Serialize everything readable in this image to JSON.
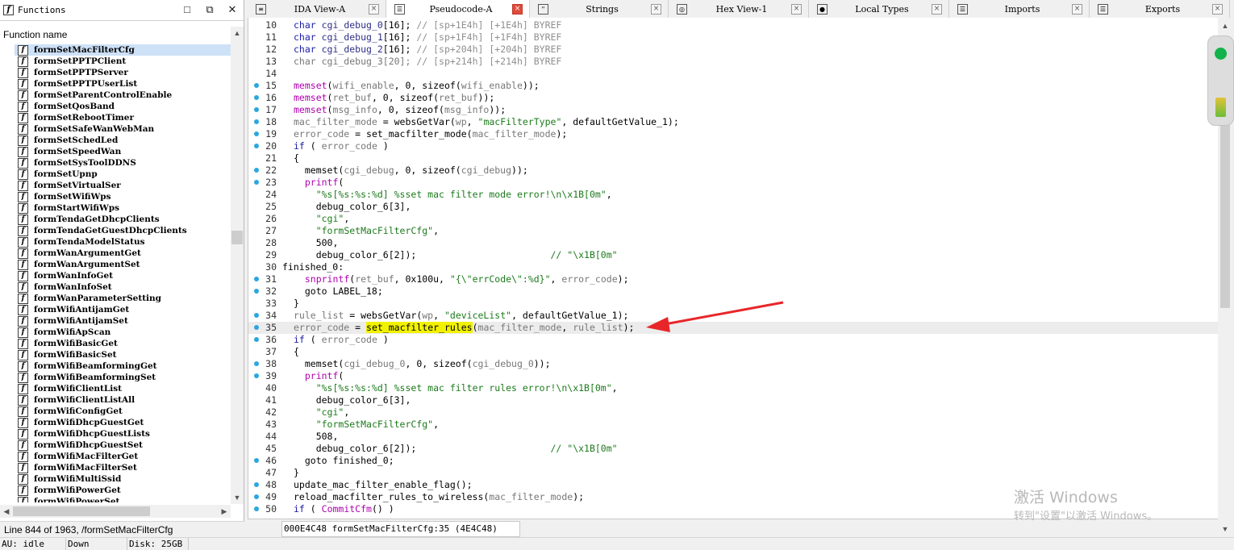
{
  "functions_pane": {
    "title": "Functions",
    "column_header": "Function name",
    "selected_index": 0,
    "items": [
      "formSetMacFilterCfg",
      "formSetPPTPClient",
      "formSetPPTPServer",
      "formSetPPTPUserList",
      "formSetParentControlEnable",
      "formSetQosBand",
      "formSetRebootTimer",
      "formSetSafeWanWebMan",
      "formSetSchedLed",
      "formSetSpeedWan",
      "formSetSysToolDDNS",
      "formSetUpnp",
      "formSetVirtualSer",
      "formSetWifiWps",
      "formStartWifiWps",
      "formTendaGetDhcpClients",
      "formTendaGetGuestDhcpClients",
      "formTendaModelStatus",
      "formWanArgumentGet",
      "formWanArgumentSet",
      "formWanInfoGet",
      "formWanInfoSet",
      "formWanParameterSetting",
      "formWifiAntijamGet",
      "formWifiAntijamSet",
      "formWifiApScan",
      "formWifiBasicGet",
      "formWifiBasicSet",
      "formWifiBeamformingGet",
      "formWifiBeamformingSet",
      "formWifiClientList",
      "formWifiClientListAll",
      "formWifiConfigGet",
      "formWifiDhcpGuestGet",
      "formWifiDhcpGuestLists",
      "formWifiDhcpGuestSet",
      "formWifiMacFilterGet",
      "formWifiMacFilterSet",
      "formWifiMultiSsid",
      "formWifiPowerGet",
      "formWifiPowerSet"
    ],
    "status": "Line 844 of 1963, /formSetMacFilterCfg"
  },
  "tabs": [
    {
      "label": "IDA View-A",
      "icon": "ida-view-icon",
      "active": false
    },
    {
      "label": "Pseudocode-A",
      "icon": "pseudocode-icon",
      "active": true
    },
    {
      "label": "Strings",
      "icon": "strings-icon",
      "active": false
    },
    {
      "label": "Hex View-1",
      "icon": "hex-view-icon",
      "active": false
    },
    {
      "label": "Local Types",
      "icon": "local-types-icon",
      "active": false
    },
    {
      "label": "Imports",
      "icon": "imports-icon",
      "active": false
    },
    {
      "label": "Exports",
      "icon": "exports-icon",
      "active": false
    }
  ],
  "code": {
    "highlight_line": 35,
    "lines": [
      {
        "n": "10",
        "dot": false,
        "t": [
          [
            "kw",
            "char "
          ],
          [
            "var",
            "cgi_debug_0"
          ],
          [
            "",
            "[16]; "
          ],
          [
            "com",
            "// [sp+1E4h] [+1E4h] BYREF"
          ]
        ]
      },
      {
        "n": "11",
        "dot": false,
        "t": [
          [
            "kw",
            "char "
          ],
          [
            "var",
            "cgi_debug_1"
          ],
          [
            "",
            "[16]; "
          ],
          [
            "com",
            "// [sp+1F4h] [+1F4h] BYREF"
          ]
        ]
      },
      {
        "n": "12",
        "dot": false,
        "t": [
          [
            "kw",
            "char "
          ],
          [
            "var",
            "cgi_debug_2"
          ],
          [
            "",
            "[16]; "
          ],
          [
            "com",
            "// [sp+204h] [+204h] BYREF"
          ]
        ]
      },
      {
        "n": "13",
        "dot": false,
        "t": [
          [
            "gray",
            "char cgi_debug_3[20]; "
          ],
          [
            "com",
            "// [sp+214h] [+214h] BYREF"
          ]
        ]
      },
      {
        "n": "14",
        "dot": false,
        "t": []
      },
      {
        "n": "15",
        "dot": true,
        "t": [
          [
            "fn",
            "memset"
          ],
          [
            "",
            "("
          ],
          [
            "gray",
            "wifi_enable"
          ],
          [
            "",
            ", 0, sizeof("
          ],
          [
            "gray",
            "wifi_enable"
          ],
          [
            "",
            "));"
          ]
        ]
      },
      {
        "n": "16",
        "dot": true,
        "t": [
          [
            "fn",
            "memset"
          ],
          [
            "",
            "("
          ],
          [
            "gray",
            "ret_buf"
          ],
          [
            "",
            ", 0, sizeof("
          ],
          [
            "gray",
            "ret_buf"
          ],
          [
            "",
            "));"
          ]
        ]
      },
      {
        "n": "17",
        "dot": true,
        "t": [
          [
            "fn",
            "memset"
          ],
          [
            "",
            "("
          ],
          [
            "gray",
            "msg_info"
          ],
          [
            "",
            ", 0, sizeof("
          ],
          [
            "gray",
            "msg_info"
          ],
          [
            "",
            "));"
          ]
        ]
      },
      {
        "n": "18",
        "dot": true,
        "t": [
          [
            "gray",
            "mac_filter_mode"
          ],
          [
            "",
            " = websGetVar("
          ],
          [
            "gray",
            "wp"
          ],
          [
            "",
            ", "
          ],
          [
            "str",
            "\"macFilterType\""
          ],
          [
            "",
            ", defaultGetValue_1);"
          ]
        ]
      },
      {
        "n": "19",
        "dot": true,
        "t": [
          [
            "gray",
            "error_code"
          ],
          [
            "",
            " = set_macfilter_mode("
          ],
          [
            "gray",
            "mac_filter_mode"
          ],
          [
            "",
            "); "
          ]
        ]
      },
      {
        "n": "20",
        "dot": true,
        "t": [
          [
            "kw",
            "if"
          ],
          [
            "",
            " ( "
          ],
          [
            "gray",
            "error_code"
          ],
          [
            "",
            " )"
          ]
        ]
      },
      {
        "n": "21",
        "dot": false,
        "t": [
          [
            "",
            "{"
          ]
        ]
      },
      {
        "n": "22",
        "dot": true,
        "t": [
          [
            "",
            "  memset("
          ],
          [
            "gray",
            "cgi_debug"
          ],
          [
            "",
            ", 0, sizeof("
          ],
          [
            "gray",
            "cgi_debug"
          ],
          [
            "",
            "));"
          ]
        ]
      },
      {
        "n": "23",
        "dot": true,
        "t": [
          [
            "",
            "  "
          ],
          [
            "fn",
            "printf"
          ],
          [
            "",
            "("
          ]
        ]
      },
      {
        "n": "24",
        "dot": false,
        "t": [
          [
            "",
            "    "
          ],
          [
            "str",
            "\"%s[%s:%s:%d] %sset mac filter mode error!\\n\\x1B[0m\""
          ],
          [
            "",
            ","
          ]
        ]
      },
      {
        "n": "25",
        "dot": false,
        "t": [
          [
            "",
            "    debug_color_6[3],"
          ]
        ]
      },
      {
        "n": "26",
        "dot": false,
        "t": [
          [
            "",
            "    "
          ],
          [
            "str",
            "\"cgi\""
          ],
          [
            "",
            ","
          ]
        ]
      },
      {
        "n": "27",
        "dot": false,
        "t": [
          [
            "",
            "    "
          ],
          [
            "str",
            "\"formSetMacFilterCfg\""
          ],
          [
            "",
            ","
          ]
        ]
      },
      {
        "n": "28",
        "dot": false,
        "t": [
          [
            "",
            "    500,"
          ]
        ]
      },
      {
        "n": "29",
        "dot": false,
        "t": [
          [
            "",
            "    debug_color_6[2]);                        "
          ],
          [
            "str",
            "// \"\\x1B[0m\""
          ]
        ]
      },
      {
        "n": "30",
        "dot": false,
        "label": true,
        "t": [
          [
            "lbl",
            "finished_0:"
          ]
        ]
      },
      {
        "n": "31",
        "dot": true,
        "t": [
          [
            "",
            "  "
          ],
          [
            "fn",
            "snprintf"
          ],
          [
            "",
            "("
          ],
          [
            "gray",
            "ret_buf"
          ],
          [
            "",
            ", 0x100u, "
          ],
          [
            "str",
            "\"{\\\"errCode\\\":%d}\""
          ],
          [
            "",
            ", "
          ],
          [
            "gray",
            "error_code"
          ],
          [
            "",
            ");"
          ]
        ]
      },
      {
        "n": "32",
        "dot": true,
        "t": [
          [
            "",
            "  goto LABEL_18;"
          ]
        ]
      },
      {
        "n": "33",
        "dot": false,
        "t": [
          [
            "",
            "}"
          ]
        ]
      },
      {
        "n": "34",
        "dot": true,
        "t": [
          [
            "gray",
            "rule_list"
          ],
          [
            "",
            " = websGetVar("
          ],
          [
            "gray",
            "wp"
          ],
          [
            "",
            ", "
          ],
          [
            "str",
            "\"deviceList\""
          ],
          [
            "",
            ", defaultGetValue_1);"
          ]
        ]
      },
      {
        "n": "35",
        "dot": true,
        "t": [
          [
            "gray",
            "error_code"
          ],
          [
            "",
            " = "
          ],
          [
            "hl",
            "set_macfilter_rules"
          ],
          [
            "",
            "("
          ],
          [
            "gray",
            "mac_filter_mode"
          ],
          [
            "",
            ", "
          ],
          [
            "gray",
            "rule_list"
          ],
          [
            "",
            ");"
          ]
        ]
      },
      {
        "n": "36",
        "dot": true,
        "t": [
          [
            "kw",
            "if"
          ],
          [
            "",
            " ( "
          ],
          [
            "gray",
            "error_code"
          ],
          [
            "",
            " )"
          ]
        ]
      },
      {
        "n": "37",
        "dot": false,
        "t": [
          [
            "",
            "{"
          ]
        ]
      },
      {
        "n": "38",
        "dot": true,
        "t": [
          [
            "",
            "  memset("
          ],
          [
            "gray",
            "cgi_debug_0"
          ],
          [
            "",
            ", 0, sizeof("
          ],
          [
            "gray",
            "cgi_debug_0"
          ],
          [
            "",
            "));"
          ]
        ]
      },
      {
        "n": "39",
        "dot": true,
        "t": [
          [
            "",
            "  "
          ],
          [
            "fn",
            "printf"
          ],
          [
            "",
            "("
          ]
        ]
      },
      {
        "n": "40",
        "dot": false,
        "t": [
          [
            "",
            "    "
          ],
          [
            "str",
            "\"%s[%s:%s:%d] %sset mac filter rules error!\\n\\x1B[0m\""
          ],
          [
            "",
            ","
          ]
        ]
      },
      {
        "n": "41",
        "dot": false,
        "t": [
          [
            "",
            "    debug_color_6[3],"
          ]
        ]
      },
      {
        "n": "42",
        "dot": false,
        "t": [
          [
            "",
            "    "
          ],
          [
            "str",
            "\"cgi\""
          ],
          [
            "",
            ","
          ]
        ]
      },
      {
        "n": "43",
        "dot": false,
        "t": [
          [
            "",
            "    "
          ],
          [
            "str",
            "\"formSetMacFilterCfg\""
          ],
          [
            "",
            ","
          ]
        ]
      },
      {
        "n": "44",
        "dot": false,
        "t": [
          [
            "",
            "    508,"
          ]
        ]
      },
      {
        "n": "45",
        "dot": false,
        "t": [
          [
            "",
            "    debug_color_6[2]);                        "
          ],
          [
            "str",
            "// \"\\x1B[0m\""
          ]
        ]
      },
      {
        "n": "46",
        "dot": true,
        "t": [
          [
            "",
            "  goto finished_0;"
          ]
        ]
      },
      {
        "n": "47",
        "dot": false,
        "t": [
          [
            "",
            "}"
          ]
        ]
      },
      {
        "n": "48",
        "dot": true,
        "t": [
          [
            "",
            "update_mac_filter_enable_flag();"
          ]
        ]
      },
      {
        "n": "49",
        "dot": true,
        "t": [
          [
            "",
            "reload_macfilter_rules_to_wireless("
          ],
          [
            "gray",
            "mac_filter_mode"
          ],
          [
            "",
            ");"
          ]
        ]
      },
      {
        "n": "50",
        "dot": true,
        "t": [
          [
            "kw",
            "if"
          ],
          [
            "",
            " ( "
          ],
          [
            "fn",
            "CommitCfm"
          ],
          [
            "",
            "() )"
          ]
        ]
      }
    ],
    "status": "000E4C48 formSetMacFilterCfg:35 (4E4C48)"
  },
  "watermark": {
    "line1": "激活 Windows",
    "line2": "转到\"设置\"以激活 Windows。"
  },
  "bottom_status": {
    "au": "AU:  idle",
    "dir": "Down",
    "disk": "Disk: 25GB"
  },
  "colors": {
    "arrow": "#e8262a",
    "highlight": "#f2f200",
    "bp_dot": "#2aa7e0"
  }
}
